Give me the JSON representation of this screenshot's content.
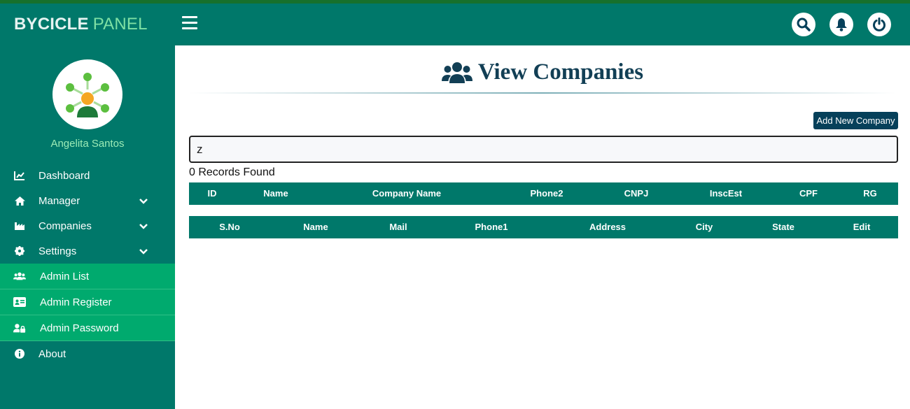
{
  "brand": {
    "part1": "BYCICLE",
    "part2": "PANEL"
  },
  "user": {
    "name": "Angelita Santos"
  },
  "sidebar": {
    "items": [
      {
        "label": "Dashboard",
        "icon": "chart-line-icon"
      },
      {
        "label": "Manager",
        "icon": "home-icon",
        "expandable": true
      },
      {
        "label": "Companies",
        "icon": "industry-icon",
        "expandable": true
      },
      {
        "label": "Settings",
        "icon": "gear-icon",
        "expandable": true
      },
      {
        "label": "Admin List",
        "icon": "users-icon",
        "active": true
      },
      {
        "label": "Admin Register",
        "icon": "id-card-icon",
        "active": true
      },
      {
        "label": "Admin Password",
        "icon": "user-lock-icon",
        "active": true
      },
      {
        "label": "About",
        "icon": "info-icon"
      }
    ]
  },
  "header": {
    "icons": [
      "search-icon",
      "bell-icon",
      "power-icon"
    ]
  },
  "main": {
    "title": "View Companies",
    "add_button": "Add New Company",
    "search": {
      "value": "z"
    },
    "records_found": "0 Records Found",
    "table1": {
      "columns": [
        "ID",
        "Name",
        "Company Name",
        "Phone2",
        "CNPJ",
        "InscEst",
        "CPF",
        "RG"
      ]
    },
    "table2": {
      "columns": [
        "S.No",
        "Name",
        "Mail",
        "Phone1",
        "Address",
        "City",
        "State",
        "Edit"
      ]
    }
  },
  "colors": {
    "primary": "#00786a",
    "active_item": "#00aa6e",
    "title": "#123f55",
    "button": "#06405a",
    "brand_accent": "#7ee0a4"
  }
}
